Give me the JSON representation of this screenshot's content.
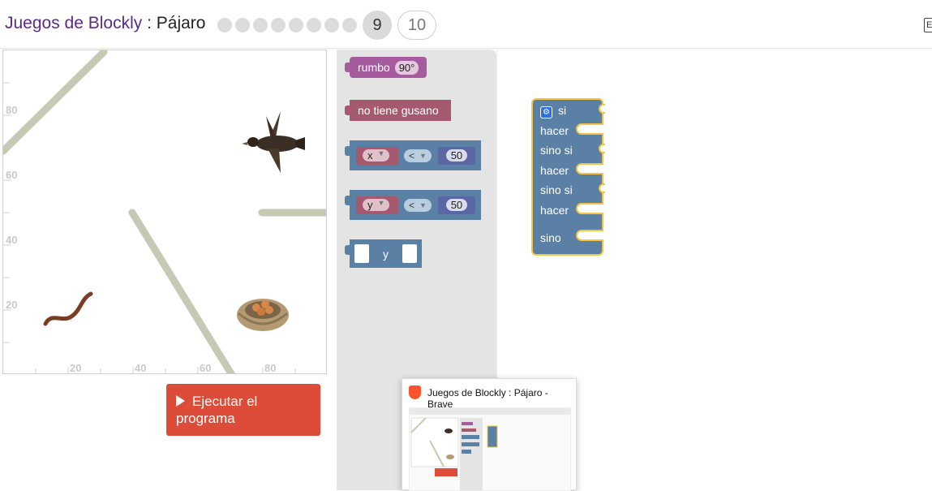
{
  "header": {
    "app_title": "Juegos de Blockly",
    "separator": " : ",
    "page_title": "Pájaro",
    "levels": {
      "completed_count": 8,
      "current": "9",
      "next": "10"
    },
    "right_button": "E"
  },
  "visualization": {
    "y_axis_labels": [
      "80",
      "60",
      "40",
      "20"
    ],
    "x_axis_labels": [
      "20",
      "40",
      "60",
      "80"
    ],
    "sprites": [
      "bird",
      "worm",
      "nest"
    ]
  },
  "run_button": {
    "label_line1": "Ejecutar el",
    "label_line2": "programa"
  },
  "flyout_blocks": {
    "heading": {
      "label": "rumbo",
      "value": "90°"
    },
    "no_worm": {
      "label": "no tiene gusano"
    },
    "compare_x": {
      "var": "x",
      "op": "<",
      "value": "50"
    },
    "compare_y": {
      "var": "y",
      "op": "<",
      "value": "50"
    },
    "logic_and": {
      "label": "y"
    }
  },
  "workspace_block": {
    "if_label": "si",
    "do1": "hacer",
    "elseif1": "sino si",
    "do2": "hacer",
    "elseif2": "sino si",
    "do3": "hacer",
    "else": "sino"
  },
  "thumbnail": {
    "title": "Juegos de Blockly : Pájaro - Brave"
  },
  "colors": {
    "accent_purple": "#5b2c87",
    "run_red": "#dd4b39",
    "logic_blue": "#5b80a5",
    "heading_purple": "#a55b9e",
    "worm_rose": "#a5596e",
    "wall_grey": "#c8c9b5",
    "highlight_yellow": "#f5c542"
  }
}
